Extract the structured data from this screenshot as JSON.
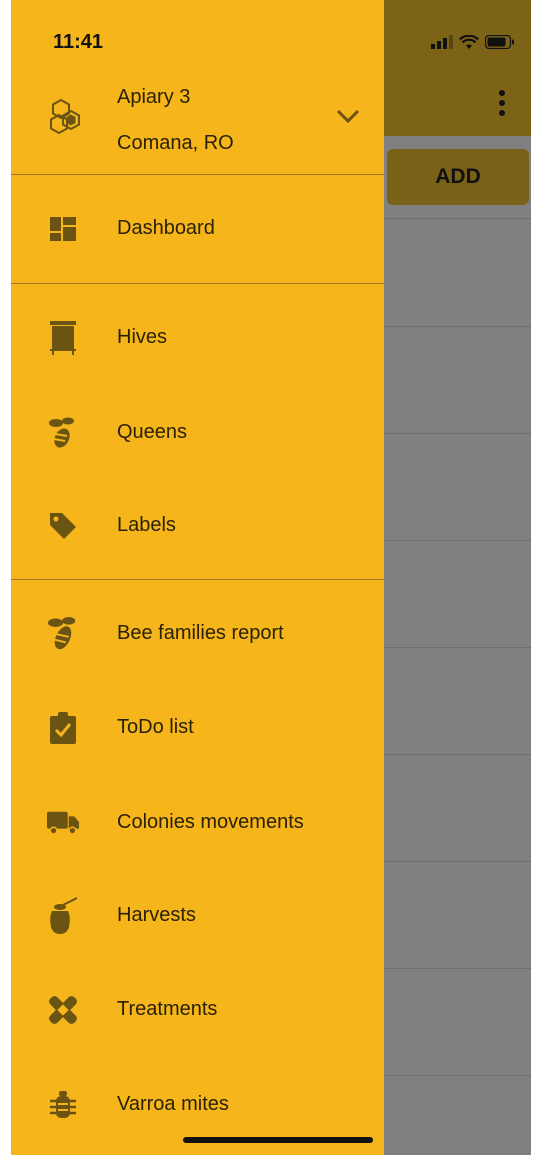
{
  "status_bar": {
    "time": "11:41"
  },
  "apiary": {
    "name": "Apiary 3",
    "location": "Comana, RO"
  },
  "menu": {
    "dashboard": "Dashboard",
    "hives": "Hives",
    "queens": "Queens",
    "labels": "Labels",
    "bee_families_report": "Bee families report",
    "todo_list": "ToDo list",
    "colonies_movements": "Colonies movements",
    "harvests": "Harvests",
    "treatments": "Treatments",
    "varroa_mites": "Varroa mites"
  },
  "background": {
    "add_button": "ADD"
  },
  "colors": {
    "drawer": "#f5b51b",
    "icon": "#6b5412",
    "header_dark": "#7d6318"
  }
}
